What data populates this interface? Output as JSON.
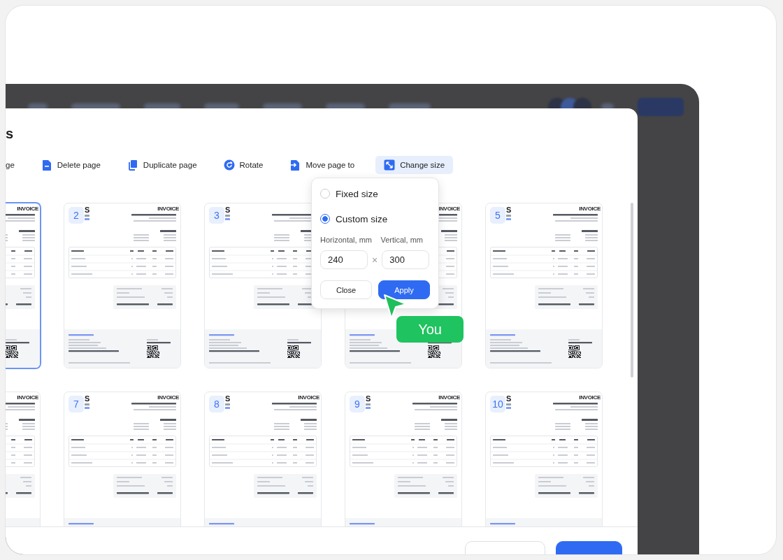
{
  "dialog": {
    "title": "s",
    "toolbar": [
      {
        "label": "ge",
        "kind": "add",
        "selected": false
      },
      {
        "label": "Delete page",
        "kind": "delete",
        "selected": false
      },
      {
        "label": "Duplicate page",
        "kind": "duplicate",
        "selected": false
      },
      {
        "label": "Rotate",
        "kind": "rotate",
        "selected": false
      },
      {
        "label": "Move page to",
        "kind": "move",
        "selected": false
      },
      {
        "label": "Change size",
        "kind": "resize",
        "selected": true
      }
    ],
    "pages": [
      {
        "kind": "partial",
        "selected": true,
        "title": "INVOICE"
      },
      {
        "kind": "full",
        "selected": false,
        "number": "2",
        "logo": "S",
        "title": "INVOICE"
      },
      {
        "kind": "full",
        "selected": false,
        "number": "3",
        "logo": "S"
      },
      {
        "kind": "full",
        "selected": false,
        "title": "INVOICE"
      },
      {
        "kind": "full",
        "selected": false,
        "number": "5",
        "logo": "S",
        "title": "INVOICE"
      },
      {
        "kind": "partial",
        "selected": false,
        "title": "INVOICE"
      },
      {
        "kind": "full",
        "selected": false,
        "number": "7",
        "logo": "S",
        "title": "INVOICE"
      },
      {
        "kind": "full",
        "selected": false,
        "number": "8",
        "logo": "S",
        "title": "INVOICE"
      },
      {
        "kind": "full",
        "selected": false,
        "number": "9",
        "logo": "S",
        "title": "INVOICE"
      },
      {
        "kind": "full",
        "selected": false,
        "number": "10",
        "logo": "S",
        "title": "INVOICE"
      }
    ],
    "size_popup": {
      "options": [
        {
          "label": "Fixed size",
          "selected": false
        },
        {
          "label": "Custom size",
          "selected": true
        }
      ],
      "fields": [
        {
          "label": "Horizontal, mm",
          "value": "240"
        },
        {
          "label": "Vertical, mm",
          "value": "300"
        }
      ],
      "separator": "×",
      "buttons": [
        {
          "label": "Close",
          "kind": "secondary"
        },
        {
          "label": "Apply",
          "kind": "primary"
        }
      ]
    },
    "footer_buttons": [
      {
        "kind": "secondary"
      },
      {
        "kind": "primary"
      }
    ]
  },
  "cursor": {
    "label": "You"
  }
}
